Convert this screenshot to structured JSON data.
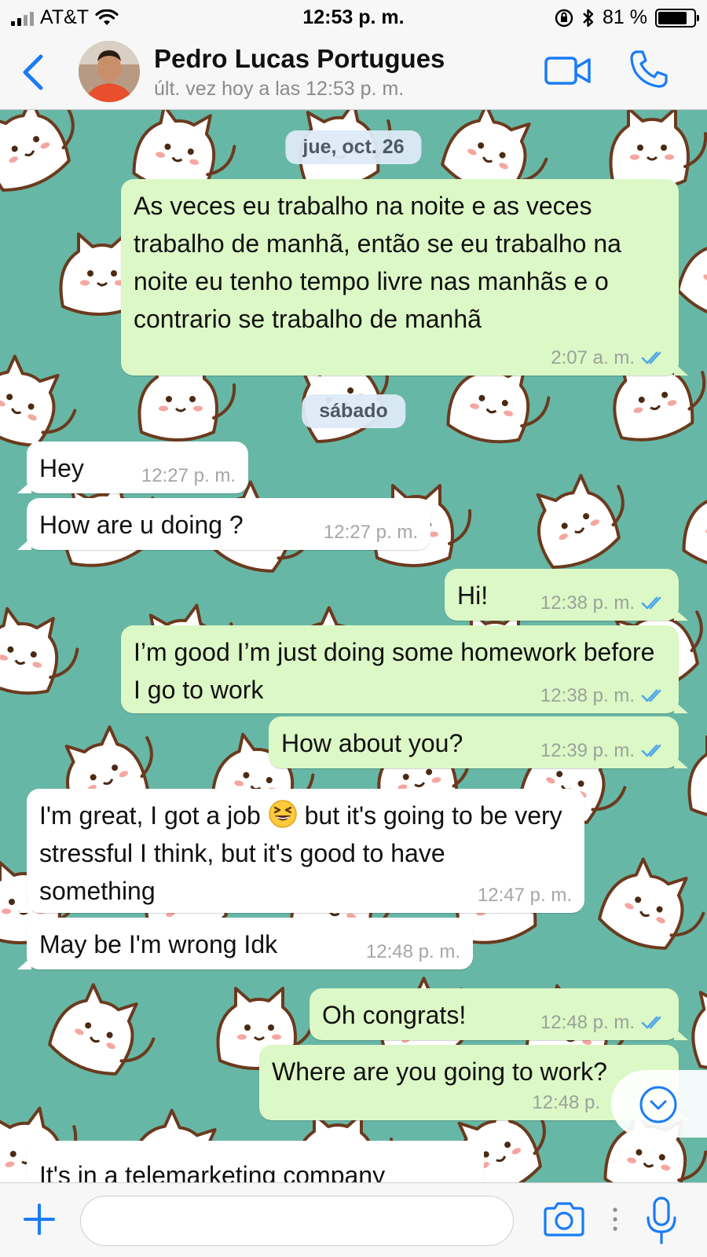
{
  "status_bar": {
    "carrier": "AT&T",
    "time": "12:53 p. m.",
    "battery": "81 %",
    "battery_level": 0.81,
    "icons": [
      "signal-icon",
      "wifi-icon",
      "orientation-lock-icon",
      "bluetooth-icon",
      "battery-icon"
    ]
  },
  "header": {
    "contact_name": "Pedro Lucas Portugues",
    "last_seen": "últ. vez hoy a las 12:53 p. m.",
    "icons": [
      "back-chevron-icon",
      "video-call-icon",
      "phone-icon"
    ]
  },
  "chat": {
    "date_separators": [
      "jue, oct. 26",
      "sábado"
    ],
    "messages": [
      {
        "direction": "outgoing",
        "text": "As veces eu trabalho na noite e as veces trabalho de manhã, então se eu trabalho na noite eu tenho tempo livre nas manhãs e o contrario se trabalho de manhã",
        "time": "2:07 a. m.",
        "read": true
      },
      {
        "direction": "incoming",
        "text": "Hey",
        "time": "12:27 p. m."
      },
      {
        "direction": "incoming",
        "text": "How are u doing ?",
        "time": "12:27 p. m."
      },
      {
        "direction": "outgoing",
        "text": "Hi!",
        "time": "12:38 p. m.",
        "read": true
      },
      {
        "direction": "outgoing",
        "text": "I’m good I’m just doing some homework before I go to work",
        "time": "12:38 p. m.",
        "read": true
      },
      {
        "direction": "outgoing",
        "text": "How about you?",
        "time": "12:39 p. m.",
        "read": true
      },
      {
        "direction": "incoming",
        "text_before_emoji": "I'm great, I got a job",
        "emoji": "grinning-squinting-face",
        "text_after_emoji": "but it's going to be very stressful I think, but it's good to have something",
        "time": "12:47 p. m."
      },
      {
        "direction": "incoming",
        "text": "May be I'm wrong Idk",
        "time": "12:48 p. m."
      },
      {
        "direction": "outgoing",
        "text": "Oh congrats!",
        "time": "12:48 p. m.",
        "read": true
      },
      {
        "direction": "outgoing",
        "text": "Where are you going to work?",
        "time": "12:48 p.",
        "read": true
      },
      {
        "direction": "incoming",
        "text": "It's in a telemarketing company"
      }
    ]
  },
  "input_bar": {
    "placeholder": "",
    "icons": [
      "plus-icon",
      "camera-icon",
      "more-dots-icon",
      "microphone-icon"
    ]
  },
  "colors": {
    "accent": "#1a7cf6",
    "wallpaper": "#67b7a6",
    "outgoing_bubble": "#dcf8c6",
    "incoming_bubble": "#ffffff",
    "read_ticks": "#4fa7e8"
  }
}
